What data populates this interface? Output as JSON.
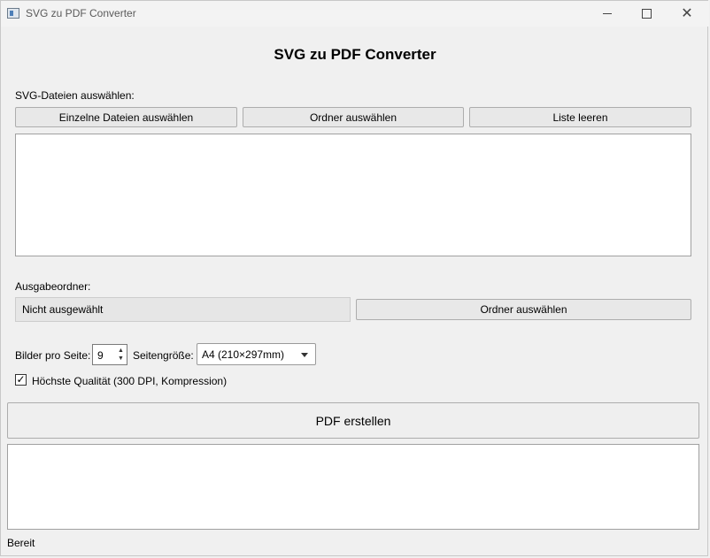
{
  "window": {
    "title": "SVG zu PDF Converter"
  },
  "main": {
    "heading": "SVG zu PDF Converter",
    "files_label": "SVG-Dateien auswählen:",
    "buttons": {
      "select_files": "Einzelne Dateien auswählen",
      "select_folder": "Ordner auswählen",
      "clear_list": "Liste leeren"
    },
    "output_label": "Ausgabeordner:",
    "output_value": "Nicht ausgewählt",
    "output_button": "Ordner auswählen",
    "per_page_label": "Bilder pro Seite:",
    "per_page_value": "9",
    "page_size_label": "Seitengröße:",
    "page_size_value": "A4 (210×297mm)",
    "quality_checked": true,
    "quality_label": "Höchste Qualität (300 DPI, Kompression)",
    "create_button": "PDF erstellen"
  },
  "status": {
    "text": "Bereit"
  },
  "icons": {
    "app": "app-icon",
    "minimize": "minimize-icon",
    "maximize": "maximize-icon",
    "close": "close-icon",
    "checkmark": "checkmark-icon"
  }
}
